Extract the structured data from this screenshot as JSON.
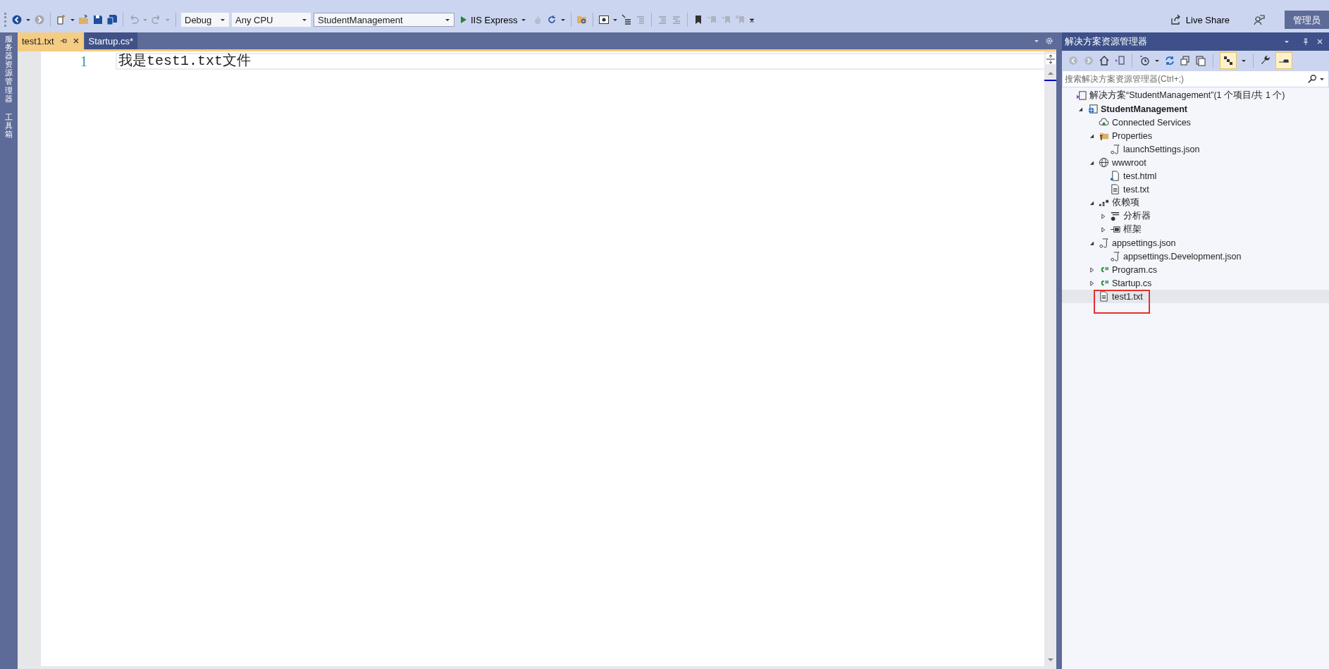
{
  "toolbar": {
    "configuration": "Debug",
    "platform": "Any CPU",
    "startup_project": "StudentManagement",
    "run_target": "IIS Express",
    "live_share": "Live Share",
    "admin_badge": "管理员"
  },
  "side_tabs": [
    {
      "label": "服务器资源管理器"
    },
    {
      "label": "工具箱"
    }
  ],
  "editor_tabs": [
    {
      "label": "test1.txt",
      "selected": true
    },
    {
      "label": "Startup.cs*",
      "selected": false
    }
  ],
  "editor": {
    "lines": [
      {
        "number": "1",
        "text": "我是test1.txt文件"
      }
    ]
  },
  "solution_explorer": {
    "title": "解决方案资源管理器",
    "search": {
      "placeholder": "搜索解决方案资源管理器(Ctrl+;)"
    },
    "tree": [
      {
        "kind": "solution",
        "label": "解决方案“StudentManagement”(1 个项目/共 1 个)",
        "selected": false,
        "outlined": false,
        "children": [
          {
            "kind": "project",
            "label": "StudentManagement",
            "expanded": true,
            "selected": false,
            "outlined": false,
            "children": [
              {
                "kind": "connected",
                "label": "Connected Services",
                "selected": false,
                "outlined": false
              },
              {
                "kind": "props",
                "label": "Properties",
                "expanded": true,
                "selected": false,
                "outlined": false,
                "children": [
                  {
                    "kind": "json",
                    "label": "launchSettings.json",
                    "selected": false,
                    "outlined": false
                  }
                ]
              },
              {
                "kind": "globe",
                "label": "wwwroot",
                "expanded": true,
                "selected": false,
                "outlined": false,
                "children": [
                  {
                    "kind": "html",
                    "label": "test.html",
                    "selected": false,
                    "outlined": false
                  },
                  {
                    "kind": "text",
                    "label": "test.txt",
                    "selected": false,
                    "outlined": false
                  }
                ]
              },
              {
                "kind": "deps",
                "label": "依赖项",
                "expanded": true,
                "selected": false,
                "outlined": false,
                "children": [
                  {
                    "kind": "analyzer",
                    "label": "分析器",
                    "expanded": false,
                    "selected": false,
                    "outlined": false
                  },
                  {
                    "kind": "framework",
                    "label": "框架",
                    "expanded": false,
                    "selected": false,
                    "outlined": false
                  }
                ]
              },
              {
                "kind": "json",
                "label": "appsettings.json",
                "expanded": true,
                "selected": false,
                "outlined": false,
                "children": [
                  {
                    "kind": "json",
                    "label": "appsettings.Development.json",
                    "selected": false,
                    "outlined": false
                  }
                ]
              },
              {
                "kind": "csharp",
                "label": "Program.cs",
                "expanded": false,
                "selected": false,
                "outlined": false
              },
              {
                "kind": "csharp",
                "label": "Startup.cs",
                "expanded": false,
                "selected": false,
                "outlined": false
              },
              {
                "kind": "text",
                "label": "test1.txt",
                "selected": true,
                "outlined": true
              }
            ]
          }
        ]
      }
    ]
  }
}
